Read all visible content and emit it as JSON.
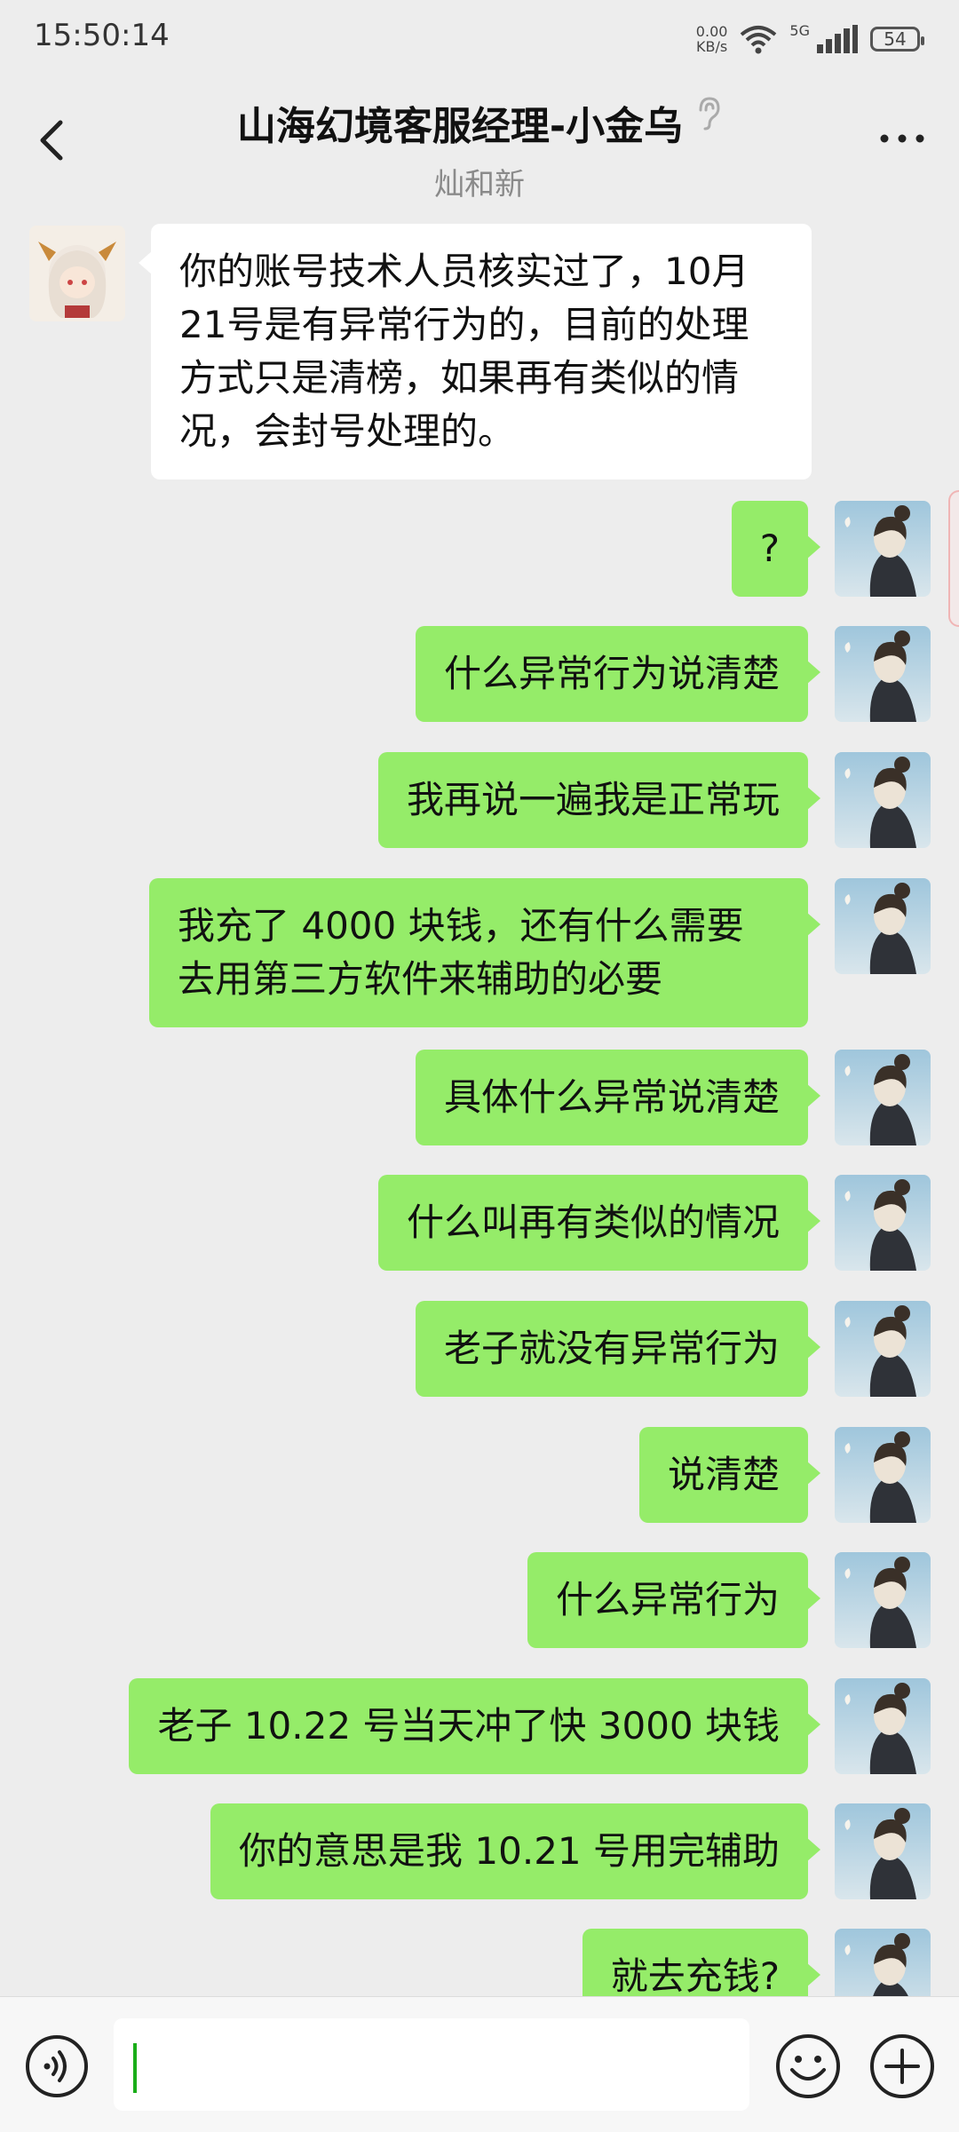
{
  "status_bar": {
    "time": "15:50:14",
    "net_speed_value": "0.00",
    "net_speed_unit": "KB/s",
    "network": "5G",
    "battery": "54"
  },
  "header": {
    "title": "山海幻境客服经理-小金乌",
    "subtitle": "灿和新",
    "icons": [
      "back-arrow-icon",
      "ear-icon",
      "more-dots-icon"
    ]
  },
  "messages": [
    {
      "from": "other",
      "text": "你的账号技术人员核实过了，10月21号是有异常行为的，目前的处理方式只是清榜，如果再有类似的情况，会封号处理的。"
    },
    {
      "from": "me",
      "text": "?"
    },
    {
      "from": "me",
      "text": "什么异常行为说清楚"
    },
    {
      "from": "me",
      "text": "我再说一遍我是正常玩"
    },
    {
      "from": "me",
      "text": "我充了 4000 块钱，还有什么需要去用第三方软件来辅助的必要"
    },
    {
      "from": "me",
      "text": "具体什么异常说清楚"
    },
    {
      "from": "me",
      "text": "什么叫再有类似的情况"
    },
    {
      "from": "me",
      "text": "老子就没有异常行为"
    },
    {
      "from": "me",
      "text": "说清楚"
    },
    {
      "from": "me",
      "text": "什么异常行为"
    },
    {
      "from": "me",
      "text": "老子 10.22 号当天冲了快 3000 块钱"
    },
    {
      "from": "me",
      "text": "你的意思是我 10.21 号用完辅助"
    },
    {
      "from": "me",
      "text": "就去充钱?"
    }
  ],
  "input_bar": {
    "text_value": "",
    "icons": [
      "voice-icon",
      "emoji-icon",
      "plus-icon"
    ]
  },
  "colors": {
    "background": "#ededed",
    "outgoing_bubble": "#95ec69",
    "incoming_bubble": "#ffffff",
    "cursor": "#1aad19"
  }
}
